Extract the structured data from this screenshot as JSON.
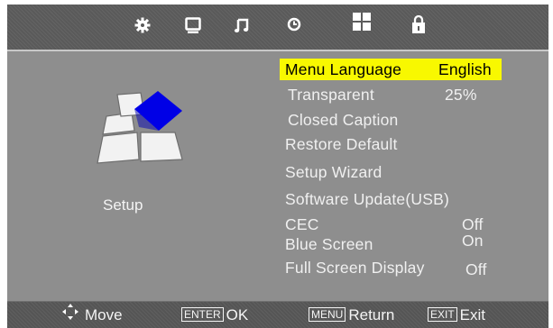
{
  "tabs": [
    {
      "icon": "gear-icon"
    },
    {
      "icon": "tv-picture-icon"
    },
    {
      "icon": "music-note-icon"
    },
    {
      "icon": "clock-icon"
    },
    {
      "icon": "grid-setup-icon"
    },
    {
      "icon": "lock-icon"
    }
  ],
  "sidebar": {
    "label": "Setup",
    "icon": "setup-cube-icon"
  },
  "menu": {
    "items": [
      {
        "label": "Menu Language",
        "value": "English",
        "selected": true
      },
      {
        "label": "Transparent",
        "value": "25%"
      },
      {
        "label": "Closed Caption",
        "value": ""
      },
      {
        "label": "Restore Default",
        "value": ""
      },
      {
        "label": "Setup Wizard",
        "value": ""
      },
      {
        "label": "Software Update(USB)",
        "value": ""
      },
      {
        "label": "CEC",
        "value": "Off"
      },
      {
        "label": "Blue Screen",
        "value": "On"
      },
      {
        "label": "Full Screen Display",
        "value": "Off"
      }
    ]
  },
  "footer": {
    "move": "Move",
    "enter_key": "ENTER",
    "ok": "OK",
    "menu_key": "MENU",
    "return": "Return",
    "exit_key": "EXIT",
    "exit": "Exit"
  },
  "colors": {
    "highlight": "#f8f800",
    "accent_blue": "#0000e6"
  }
}
